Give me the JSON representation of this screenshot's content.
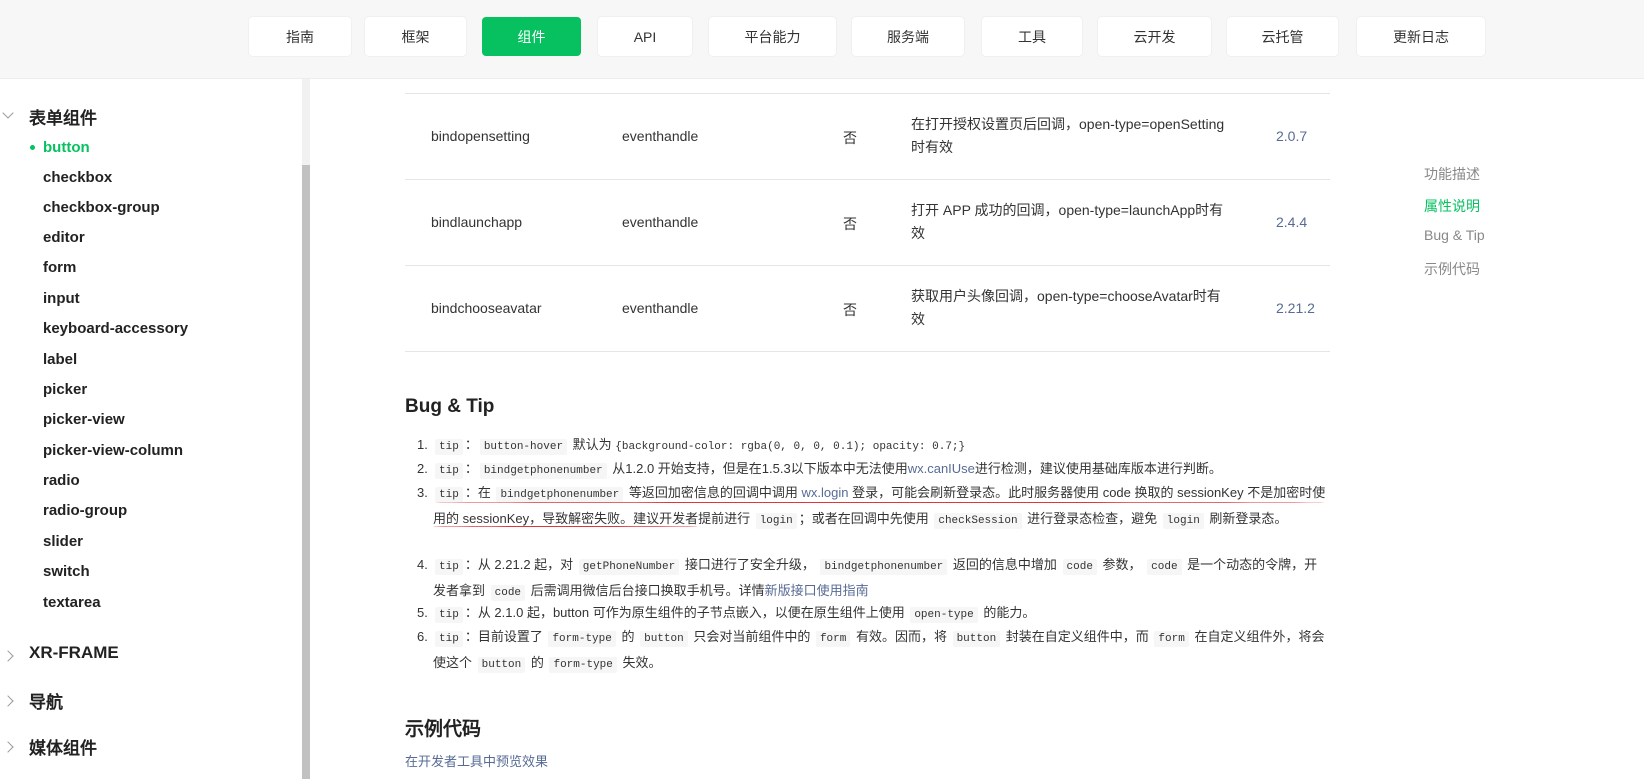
{
  "nav": {
    "tabs": [
      {
        "label": "指南"
      },
      {
        "label": "框架"
      },
      {
        "label": "组件",
        "active": true
      },
      {
        "label": "API"
      },
      {
        "label": "平台能力"
      },
      {
        "label": "服务端"
      },
      {
        "label": "工具"
      },
      {
        "label": "云开发"
      },
      {
        "label": "云托管"
      },
      {
        "label": "更新日志"
      }
    ]
  },
  "sidebar": {
    "group1": "表单组件",
    "items": [
      "button",
      "checkbox",
      "checkbox-group",
      "editor",
      "form",
      "input",
      "keyboard-accessory",
      "label",
      "picker",
      "picker-view",
      "picker-view-column",
      "radio",
      "radio-group",
      "slider",
      "switch",
      "textarea"
    ],
    "group2": "XR-FRAME",
    "group3": "导航",
    "group4": "媒体组件"
  },
  "table": {
    "rows": [
      {
        "name": "bindopensetting",
        "type": "eventhandle",
        "required": "否",
        "desc": "在打开授权设置页后回调，open-type=openSetting时有效",
        "version": "2.0.7"
      },
      {
        "name": "bindlaunchapp",
        "type": "eventhandle",
        "required": "否",
        "desc": "打开 APP 成功的回调，open-type=launchApp时有效",
        "version": "2.4.4"
      },
      {
        "name": "bindchooseavatar",
        "type": "eventhandle",
        "required": "否",
        "desc": "获取用户头像回调，open-type=chooseAvatar时有效",
        "version": "2.21.2"
      }
    ]
  },
  "bugtip": {
    "title": "Bug & Tip",
    "tips": {
      "t1": {
        "num": "1.",
        "tip": "tip",
        "colon": "：",
        "code1": "button-hover",
        "text1": " 默认为 ",
        "code2": "{background-color: rgba(0, 0, 0, 0.1); opacity: 0.7;}"
      },
      "t2": {
        "num": "2.",
        "tip": "tip",
        "colon": "：",
        "code1": "bindgetphonenumber",
        "text1": " 从1.2.0 开始支持，但是在1.5.3以下版本中无法使用",
        "link": "wx.canIUse",
        "text2": "进行检测，建议使用基础库版本进行判断。"
      },
      "t3": {
        "num": "3.",
        "tip": "tip",
        "colon": "：在 ",
        "code1": "bindgetphonenumber",
        "text1": " 等返回加密信息的回调中调用 ",
        "link": "wx.login",
        "text2": " 登录，可能会刷新登录态。此时服务器使用 code 换取的 sessionKey 不是加密时使用的 sessionKey，导致解密失败。建议开发者提前进行 ",
        "code2": "login",
        "text3": "；或者在回调中先使用 ",
        "code3": "checkSession",
        "text4": " 进行登录态检查，避免 ",
        "code4": "login",
        "text5": " 刷新登录态。"
      },
      "t4": {
        "num": "4.",
        "tip": "tip",
        "colon": "：从 2.21.2 起，对 ",
        "code1": "getPhoneNumber",
        "text1": " 接口进行了安全升级， ",
        "code2": "bindgetphonenumber",
        "text2": " 返回的信息中增加 ",
        "code3": "code",
        "text3": " 参数， ",
        "code4": "code",
        "text4": " 是一个动态的令牌，开发者拿到 ",
        "code5": "code",
        "text5": " 后需调用微信后台接口换取手机号。详情",
        "link": "新版接口使用指南"
      },
      "t5": {
        "num": "5.",
        "tip": "tip",
        "colon": "：从 2.1.0 起，button 可作为原生组件的子节点嵌入，以便在原生组件上使用 ",
        "code1": "open-type",
        "text1": " 的能力。"
      },
      "t6": {
        "num": "6.",
        "tip": "tip",
        "colon": "：目前设置了 ",
        "code1": "form-type",
        "text1": " 的 ",
        "code2": "button",
        "text2": " 只会对当前组件中的 ",
        "code3": "form",
        "text3": " 有效。因而，将 ",
        "code4": "button",
        "text4": " 封装在自定义组件中，而 ",
        "code5": "form",
        "text5": " 在自定义组件外，将会使这个 ",
        "code6": "button",
        "text6": " 的 ",
        "code7": "form-type",
        "text7": " 失效。"
      }
    }
  },
  "example": {
    "title": "示例代码",
    "link": "在开发者工具中预览效果"
  },
  "toc": {
    "items": [
      "功能描述",
      "属性说明",
      "Bug & Tip",
      "示例代码"
    ]
  },
  "colors": {
    "accent": "#07c160",
    "link": "#576b95",
    "underline": "#e0353b"
  }
}
